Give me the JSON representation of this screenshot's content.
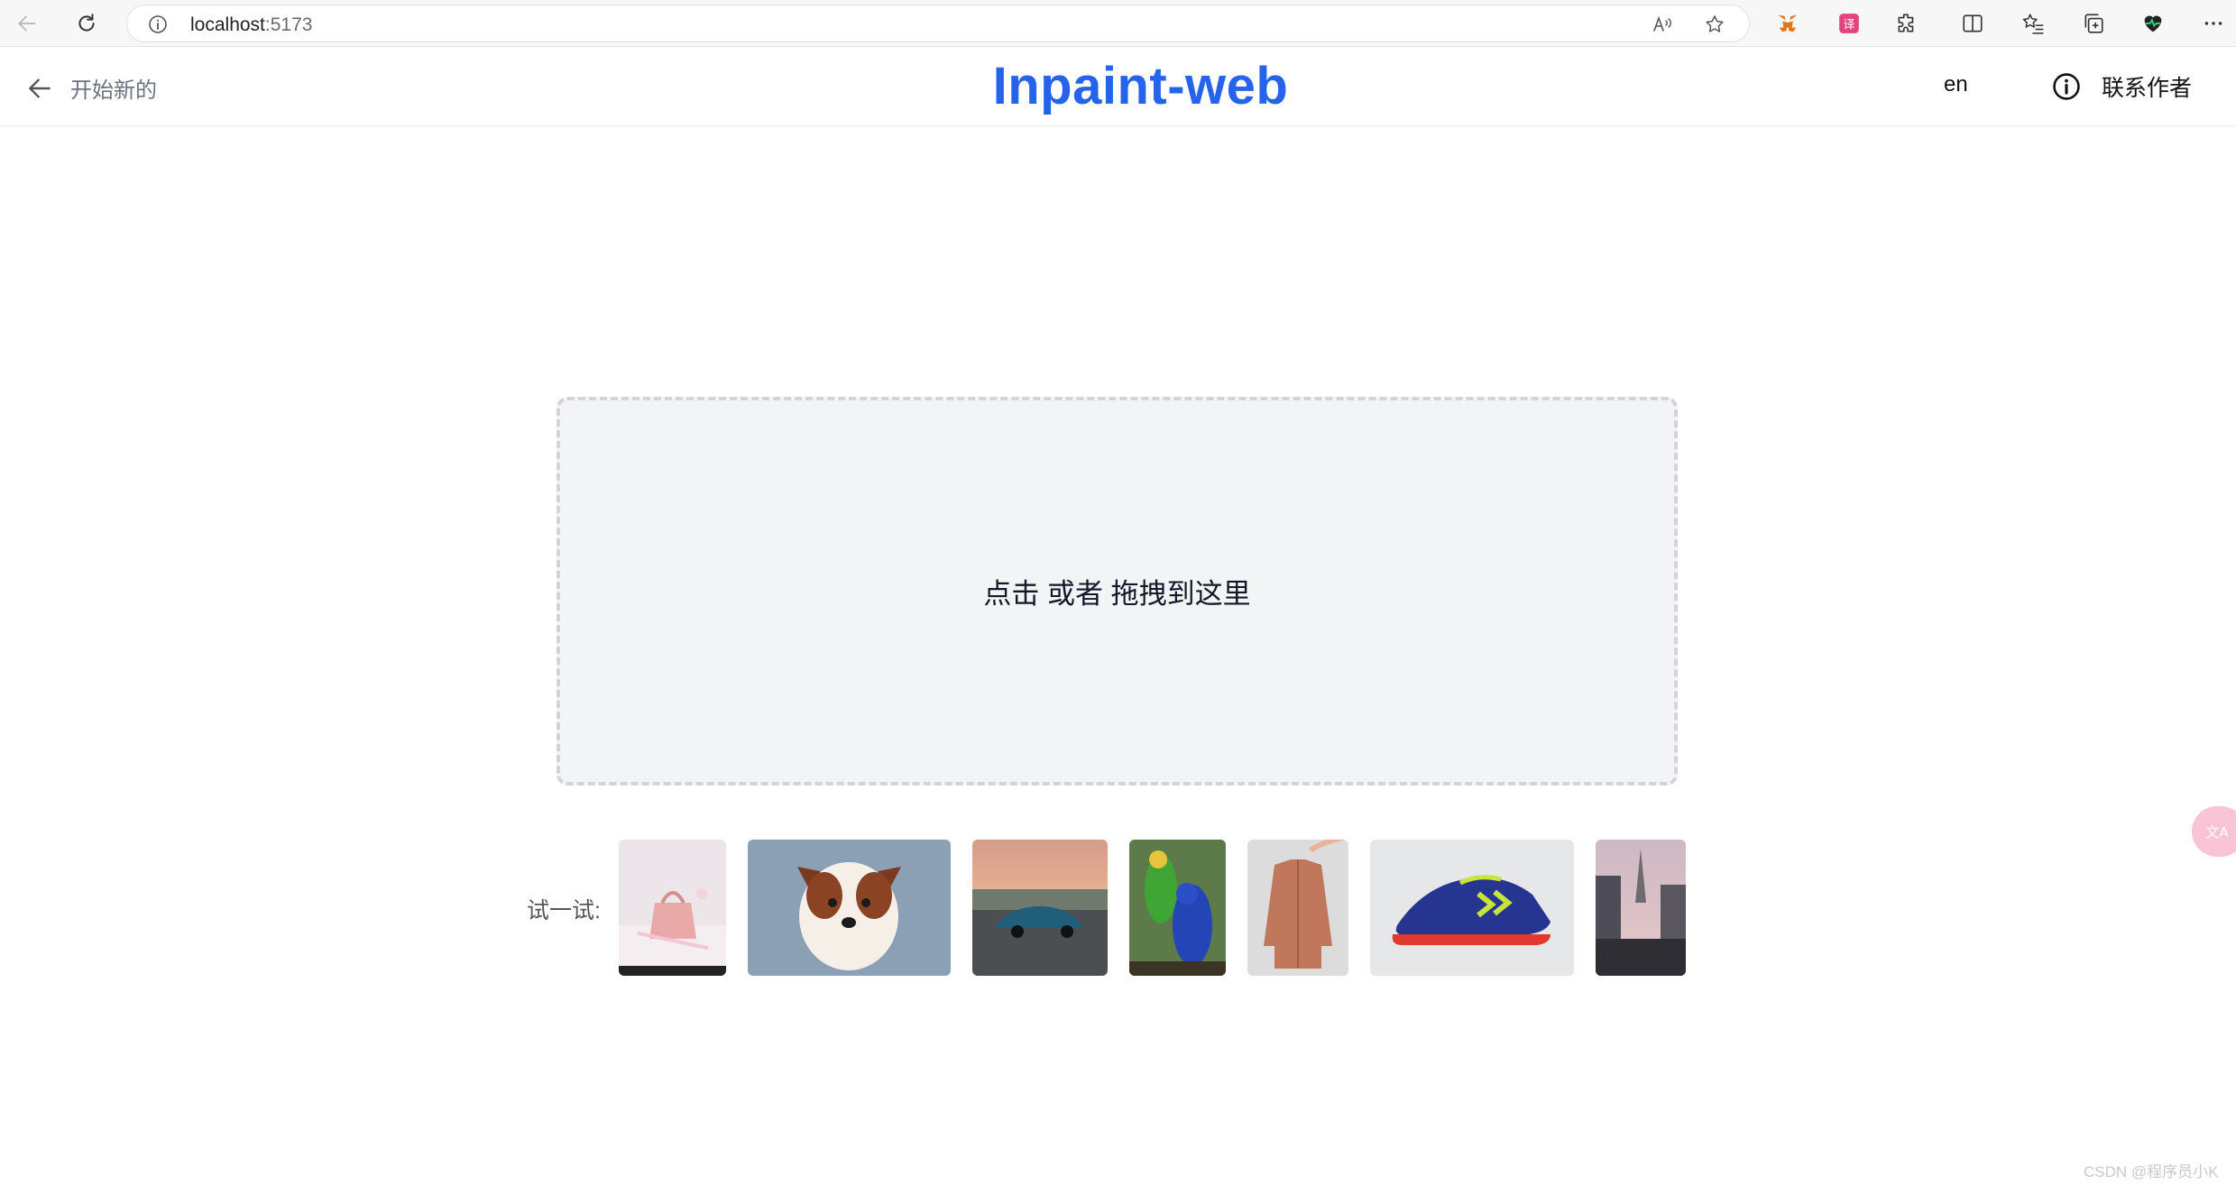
{
  "browser": {
    "address_host": "localhost",
    "address_port": ":5173"
  },
  "header": {
    "back_label": "开始新的",
    "title": "Inpaint-web",
    "lang": "en",
    "contact_label": "联系作者"
  },
  "dropzone": {
    "text": "点击 或者 拖拽到这里"
  },
  "samples": {
    "label": "试一试:",
    "items": [
      "bag",
      "dog",
      "car",
      "parrots",
      "jacket",
      "shoe",
      "paris"
    ]
  },
  "watermark": "CSDN @程序员小K",
  "colors": {
    "accent": "#2563eb",
    "dropzone_bg": "#f3f4f6",
    "dropzone_border": "#d4d4d8"
  }
}
